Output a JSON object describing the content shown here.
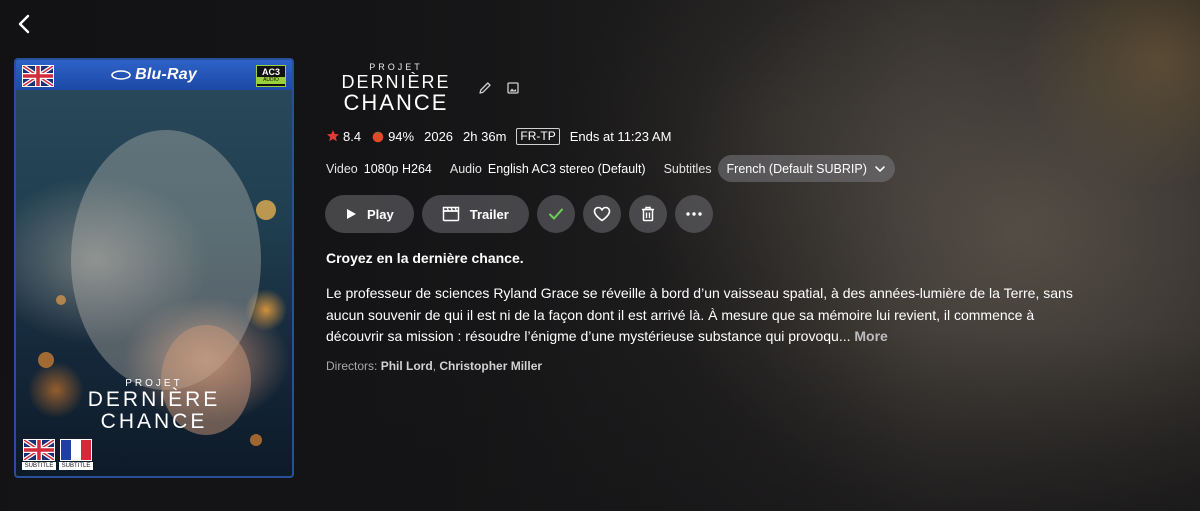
{
  "navigation": {
    "back_icon": "chevron-left-icon"
  },
  "poster": {
    "format_label": "Blu-Ray",
    "audio_badge": {
      "codec": "AC3",
      "label": "AUDIO"
    },
    "title_small": "PROJET",
    "title_line1": "DERNIÈRE",
    "title_line2": "CHANCE",
    "subtitle_badges": [
      {
        "flag": "uk-flag-icon",
        "label": "SUBTITLE"
      },
      {
        "flag": "france-flag-icon",
        "label": "SUBTITLE"
      }
    ],
    "border_color": "#2a4f9a",
    "topbar_color": "#2e62c7"
  },
  "logo": {
    "small": "PROJET",
    "line1": "DERNIÈRE",
    "line2": "CHANCE"
  },
  "meta": {
    "community_rating": "8.4",
    "critic_rating": "94%",
    "year": "2026",
    "runtime": "2h 36m",
    "certification": "FR-TP",
    "ends_at": "Ends at 11:23 AM",
    "star_color": "#e03a32",
    "tomato_color": "#e04a2a"
  },
  "streams": {
    "video_label": "Video",
    "video_value": "1080p H264",
    "audio_label": "Audio",
    "audio_value": "English AC3 stereo (Default)",
    "subtitles_label": "Subtitles",
    "subtitles_value": "French (Default SUBRIP)"
  },
  "actions": {
    "play_label": "Play",
    "trailer_label": "Trailer",
    "watched_color": "#6ccf5b"
  },
  "tagline": "Croyez en la dernière chance.",
  "overview": {
    "text": "Le professeur de sciences Ryland Grace se réveille à bord d’un vaisseau spatial, à des années-lumière de la Terre, sans aucun souvenir de qui il est ni de la façon dont il est arrivé là. À mesure que sa mémoire lui revient, il commence à découvrir sa mission : résoudre l’énigme d’une mystérieuse substance qui provoqu...",
    "more_label": "More"
  },
  "directors": {
    "label": "Directors:",
    "names": [
      "Phil Lord",
      "Christopher Miller"
    ],
    "separator": ","
  }
}
